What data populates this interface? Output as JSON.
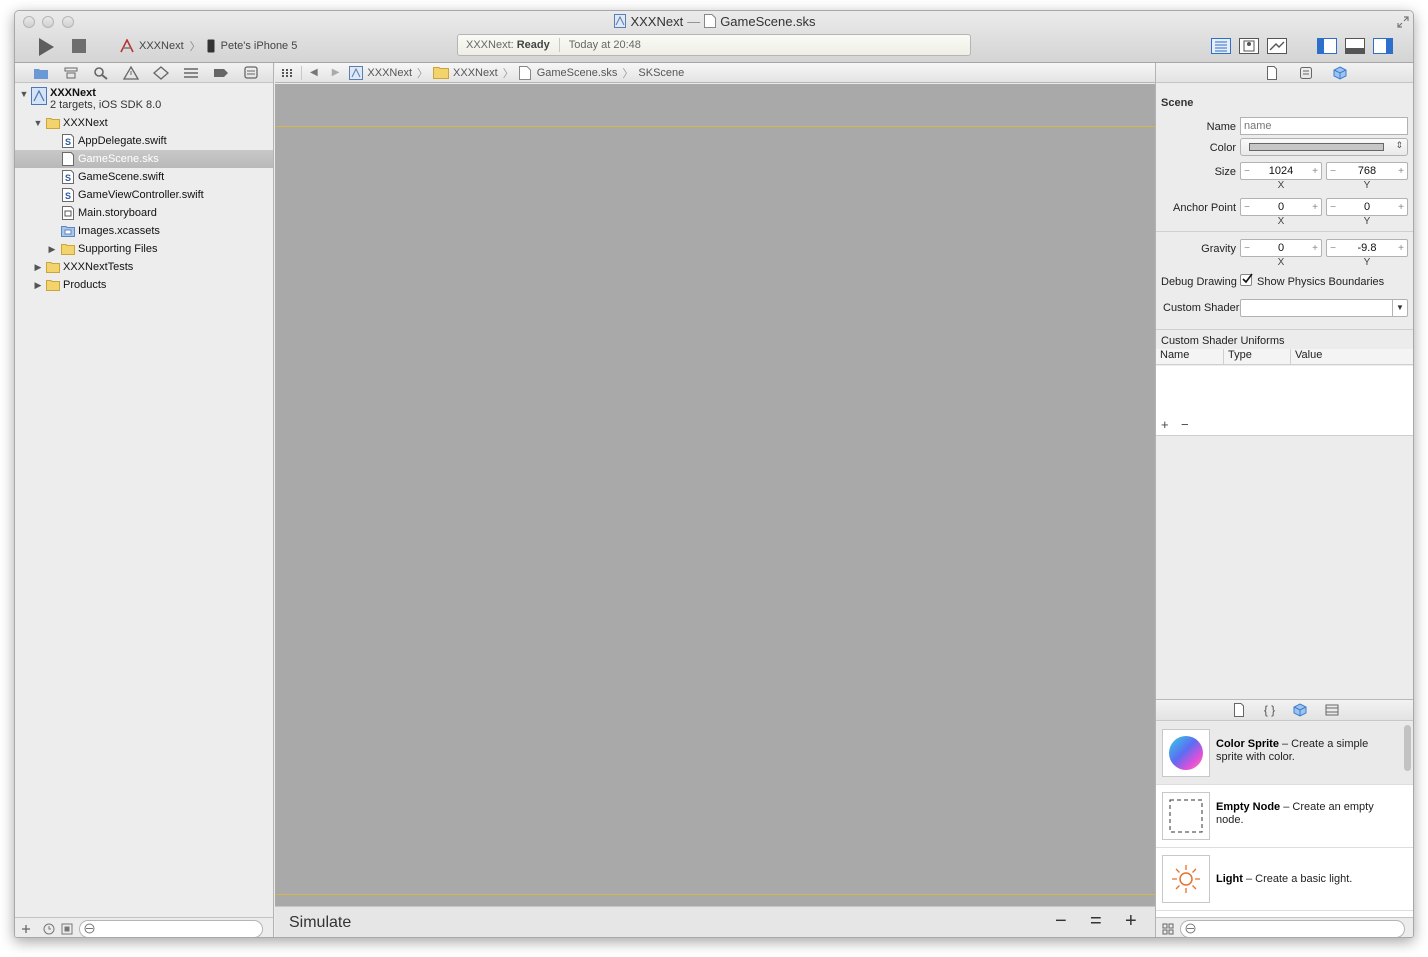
{
  "window": {
    "title_project": "XXXNext",
    "title_sep": "—",
    "title_file": "GameScene.sks"
  },
  "toolbar": {
    "scheme_target": "XXXNext",
    "scheme_device": "Pete's iPhone 5",
    "activity_project": "XXXNext:",
    "activity_status": "Ready",
    "activity_time": "Today at 20:48"
  },
  "navigator": {
    "project": {
      "name": "XXXNext",
      "subtitle": "2 targets, iOS SDK 8.0"
    },
    "items": [
      {
        "label": "XXXNext",
        "type": "folder",
        "depth": 1,
        "disclosure": "open"
      },
      {
        "label": "AppDelegate.swift",
        "type": "swift",
        "depth": 2
      },
      {
        "label": "GameScene.sks",
        "type": "file",
        "depth": 2,
        "selected": true
      },
      {
        "label": "GameScene.swift",
        "type": "swift",
        "depth": 2
      },
      {
        "label": "GameViewController.swift",
        "type": "swift",
        "depth": 2
      },
      {
        "label": "Main.storyboard",
        "type": "storyboard",
        "depth": 2
      },
      {
        "label": "Images.xcassets",
        "type": "assets",
        "depth": 2
      },
      {
        "label": "Supporting Files",
        "type": "folder",
        "depth": 2,
        "disclosure": "closed"
      },
      {
        "label": "XXXNextTests",
        "type": "folder",
        "depth": 1,
        "disclosure": "closed"
      },
      {
        "label": "Products",
        "type": "folder",
        "depth": 1,
        "disclosure": "closed"
      }
    ]
  },
  "jumpbar": {
    "crumbs": [
      "XXXNext",
      "XXXNext",
      "GameScene.sks",
      "SKScene"
    ]
  },
  "editor": {
    "simulate_label": "Simulate",
    "zoom_out": "−",
    "zoom_reset": "=",
    "zoom_in": "+"
  },
  "inspector": {
    "section": "Scene",
    "name_label": "Name",
    "name_placeholder": "name",
    "color_label": "Color",
    "size_label": "Size",
    "size_x": "1024",
    "size_y": "768",
    "anchor_label": "Anchor Point",
    "anchor_x": "0",
    "anchor_y": "0",
    "gravity_label": "Gravity",
    "gravity_x": "0",
    "gravity_y": "-9.8",
    "axis_x": "X",
    "axis_y": "Y",
    "debug_label": "Debug Drawing",
    "debug_option": "Show Physics Boundaries",
    "debug_checked": true,
    "shader_label": "Custom Shader",
    "uniforms_title": "Custom Shader Uniforms",
    "uniforms_columns": [
      "Name",
      "Type",
      "Value"
    ],
    "add": "+",
    "remove": "−"
  },
  "library": {
    "items": [
      {
        "title": "Color Sprite",
        "desc": " – Create a simple sprite with color."
      },
      {
        "title": "Empty Node",
        "desc": " – Create an empty node."
      },
      {
        "title": "Light",
        "desc": " – Create a basic light."
      }
    ]
  },
  "colors": {
    "canvas": "#a9a9a9",
    "scene_bounds": "#d2b84a",
    "selection": "#bdbdbd",
    "light_icon": "#e8712a"
  }
}
